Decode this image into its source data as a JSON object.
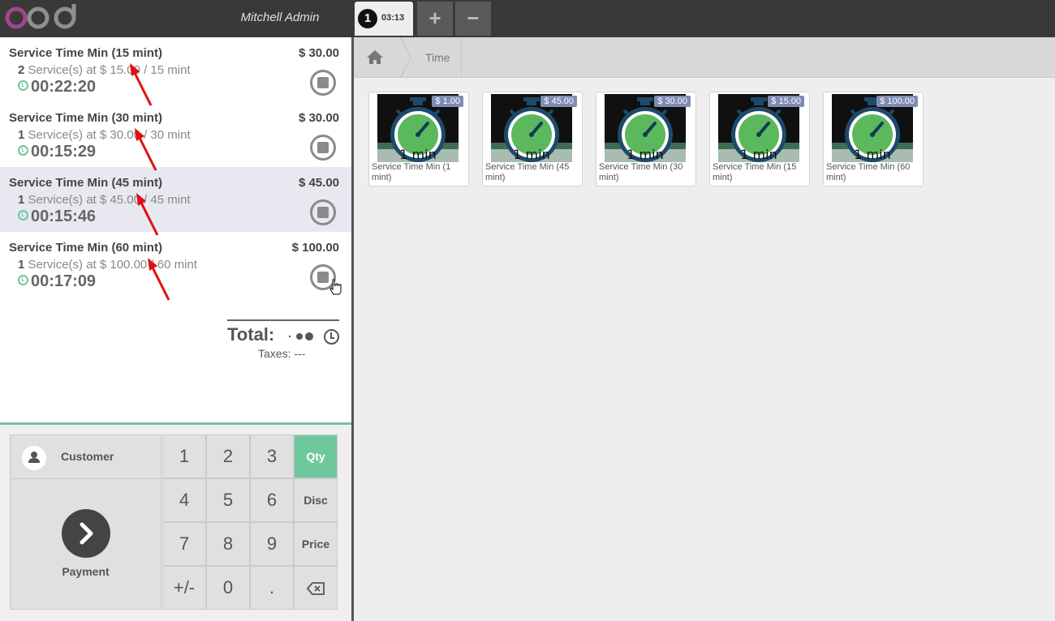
{
  "header": {
    "logo_text": "odoo",
    "user_name": "Mitchell Admin",
    "order_tab": {
      "number": "1",
      "time": "03:13"
    },
    "add_order_label": "+",
    "remove_order_label": "−"
  },
  "order_lines": [
    {
      "name": "Service Time Min (15 mint)",
      "price": "$ 30.00",
      "qty": "2",
      "info": "Service(s) at $ 15.00 / 15 mint",
      "timer": "00:22:20",
      "selected": false
    },
    {
      "name": "Service Time Min (30 mint)",
      "price": "$ 30.00",
      "qty": "1",
      "info": "Service(s) at $ 30.00 / 30 mint",
      "timer": "00:15:29",
      "selected": false
    },
    {
      "name": "Service Time Min (45 mint)",
      "price": "$ 45.00",
      "qty": "1",
      "info": "Service(s) at $ 45.00 / 45 mint",
      "timer": "00:15:46",
      "selected": true
    },
    {
      "name": "Service Time Min (60 mint)",
      "price": "$ 100.00",
      "qty": "1",
      "info": "Service(s) at $ 100.00 / 60 mint",
      "timer": "00:17:09",
      "selected": false
    }
  ],
  "summary": {
    "total_label": "Total:",
    "taxes_text": "Taxes: ---"
  },
  "control": {
    "customer_label": "Customer",
    "payment_label": "Payment"
  },
  "numpad": {
    "keys": [
      "1",
      "2",
      "3",
      "4",
      "5",
      "6",
      "7",
      "8",
      "9",
      "+/-",
      "0",
      "."
    ],
    "modes": [
      "Qty",
      "Disc",
      "Price"
    ],
    "active_mode": "Qty",
    "backspace_icon": "backspace-icon"
  },
  "breadcrumb": {
    "home_icon": "home-icon",
    "category": "Time"
  },
  "products": [
    {
      "name": "Service Time Min (1 mint)",
      "price": "$ 1.00",
      "image_label": "1 min"
    },
    {
      "name": "Service Time Min (45 mint)",
      "price": "$ 45.00",
      "image_label": "1 min"
    },
    {
      "name": "Service Time Min (30 mint)",
      "price": "$ 30.00",
      "image_label": "1 min"
    },
    {
      "name": "Service Time Min (15 mint)",
      "price": "$ 15.00",
      "image_label": "1 min"
    },
    {
      "name": "Service Time Min (60 mint)",
      "price": "$ 100.00",
      "image_label": "1 min"
    }
  ],
  "colors": {
    "accent": "#6ec89b",
    "topbar": "#393939",
    "price_badge": "#7e8bb3",
    "annotation_arrow": "#e01010"
  }
}
